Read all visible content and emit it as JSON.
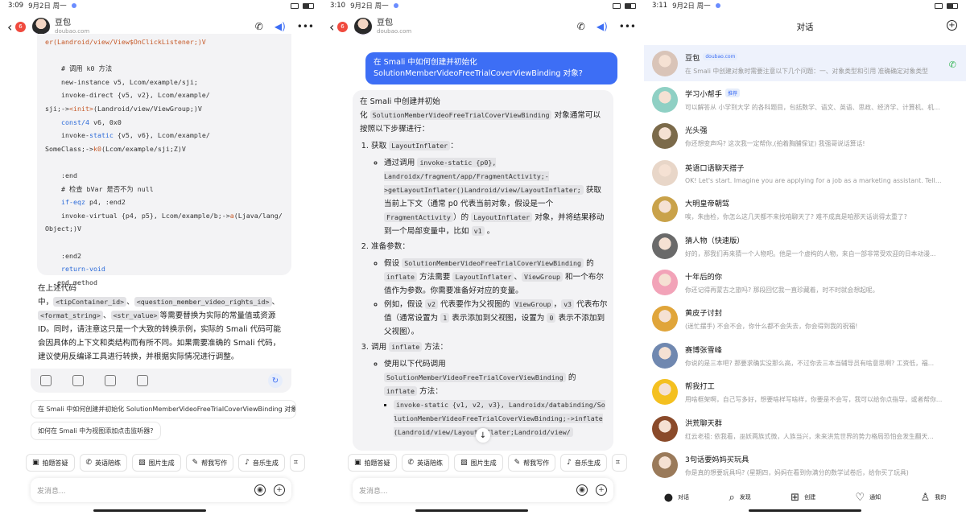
{
  "p1": {
    "status": {
      "time": "3:09",
      "date": "9月2日 周一"
    },
    "header": {
      "title": "豆包",
      "subtitle": "doubao.com",
      "badge": "6"
    },
    "code": [
      {
        "segs": [
          [
            "or",
            "er(Landroid/view/View$OnClickListener;)V"
          ]
        ]
      },
      {
        "segs": [
          [
            "n",
            ""
          ]
        ]
      },
      {
        "segs": [
          [
            "n",
            "    # 调用 k0 方法"
          ]
        ]
      },
      {
        "segs": [
          [
            "n",
            "    new-instance v5, Lcom/example/sji;"
          ]
        ]
      },
      {
        "segs": [
          [
            "n",
            "    invoke-direct {v5, v2}, Lcom/example/"
          ]
        ]
      },
      {
        "segs": [
          [
            "n",
            "sji;->"
          ],
          [
            "or",
            "<init>"
          ],
          [
            "n",
            "(Landroid/view/ViewGroup;)V"
          ]
        ]
      },
      {
        "segs": [
          [
            "bl",
            "    const/4"
          ],
          [
            "n",
            " v6, 0x0"
          ]
        ]
      },
      {
        "segs": [
          [
            "n",
            "    invoke-"
          ],
          [
            "bl",
            "static"
          ],
          [
            "n",
            " {v5, v6}, Lcom/example/"
          ]
        ]
      },
      {
        "segs": [
          [
            "n",
            "SomeClass;->"
          ],
          [
            "or",
            "k0"
          ],
          [
            "n",
            "(Lcom/example/sji;Z)V"
          ]
        ]
      },
      {
        "segs": [
          [
            "n",
            ""
          ]
        ]
      },
      {
        "segs": [
          [
            "n",
            "    :end"
          ]
        ]
      },
      {
        "segs": [
          [
            "n",
            "    # 检查 bVar 是否不为 null"
          ]
        ]
      },
      {
        "segs": [
          [
            "bl",
            "    if-eqz"
          ],
          [
            "n",
            " p4, :end2"
          ]
        ]
      },
      {
        "segs": [
          [
            "n",
            "    invoke-virtual {p4, p5}, Lcom/example/b;->"
          ],
          [
            "or",
            "a"
          ],
          [
            "n",
            "(Ljava/lang/"
          ]
        ]
      },
      {
        "segs": [
          [
            "n",
            "Object;)V"
          ]
        ]
      },
      {
        "segs": [
          [
            "n",
            ""
          ]
        ]
      },
      {
        "segs": [
          [
            "n",
            "    :end2"
          ]
        ]
      },
      {
        "segs": [
          [
            "bl",
            "    return-void"
          ]
        ]
      },
      {
        "segs": [
          [
            "n",
            "  .end method"
          ]
        ]
      }
    ],
    "para1": "在上述代码",
    "para2a": "中，",
    "c1": "<tipContainer_id>",
    "sep1": "、",
    "c2": "<question_member_video_rights_id>",
    "sep2": "、",
    "c3": "<format_string>",
    "sep3": "、",
    "c4": "<str_value>",
    "para2b": "等需要替换为实际的常量值或资源ID。同时，请注意这只是一个大致的转换示例，实际的 Smali 代码可能会因具体的上下文和类结构而有所不同。如果需要准确的 Smali 代码，建议使用反编译工具进行转换，并根据实际情况进行调整。",
    "suggestions": [
      "在 Smali 中如何创建并初始化 SolutionMemberVideoFreeTrialCoverViewBinding 对象?",
      "如何在 Smali 中为视图添加点击监听器?"
    ],
    "tools": [
      "拍题答疑",
      "英语陪练",
      "图片生成",
      "帮我写作",
      "音乐生成"
    ],
    "placeholder": "发消息..."
  },
  "p2": {
    "status": {
      "time": "3:10",
      "date": "9月2日 周一"
    },
    "header": {
      "title": "豆包",
      "subtitle": "doubao.com",
      "badge": "6"
    },
    "user_msg": "在 Smali 中如何创建并初始化 SolutionMemberVideoFreeTrialCoverViewBinding 对象?",
    "intro1": "在 Smali 中创建并初始",
    "intro2": "化",
    "intro_code": "SolutionMemberVideoFreeTrialCoverViewBinding",
    "intro3": "对象通常可以按照以下步骤进行：",
    "step1_t": "获取",
    "step1_c": "LayoutInflater",
    "step1_colon": "：",
    "s1b_a": "通过调用",
    "s1b_c1": "invoke-static {p0}, Landroidx/fragment/app/FragmentActivity;->getLayoutInflater()Landroid/view/LayoutInflater;",
    "s1b_b": "获取当前上下文（通常 p0 代表当前对象，假设是一个",
    "s1b_c2": "FragmentActivity",
    "s1b_d": "）的",
    "s1b_c3": "LayoutInflater",
    "s1b_e": "对象，并将结果移动到一个局部变量中，比如",
    "s1b_c4": "v1",
    "s1b_f": "。",
    "step2_t": "准备参数：",
    "s2b1_a": "假设",
    "s2b1_c1": "SolutionMemberVideoFreeTrialCoverViewBinding",
    "s2b1_b": "的",
    "s2b1_c2": "inflate",
    "s2b1_c": "方法需要",
    "s2b1_c3": "LayoutInflater",
    "s2b1_d": "、",
    "s2b1_c4": "ViewGroup",
    "s2b1_e": "和一个布尔值作为参数。你需要准备好对应的变量。",
    "s2b2_a": "例如，假设",
    "s2b2_c1": "v2",
    "s2b2_b": "代表要作为父视图的",
    "s2b2_c2": "ViewGroup",
    "s2b2_c": "，",
    "s2b2_c3": "v3",
    "s2b2_d": "代表布尔值（通常设置为",
    "s2b2_c4": "1",
    "s2b2_e": "表示添加到父视图，设置为",
    "s2b2_c5": "0",
    "s2b2_f": "表示不添加到父视图）。",
    "step3_t": "调用",
    "step3_c": "inflate",
    "step3_e": "方法：",
    "s3b_a": "使用以下代码调用",
    "s3b_c1": "SolutionMemberVideoFreeTrialCoverViewBinding",
    "s3b_b": "的",
    "s3b_c2": "inflate",
    "s3b_c": "方法：",
    "s3b_code": "invoke-static {v1, v2, v3}, Landroidx/databinding/SolutionMemberVideoFreeTrialCoverViewBinding;->inflate(Landroid/view/LayoutInflater;Landroid/view/",
    "tools": [
      "拍题答疑",
      "英语陪练",
      "图片生成",
      "帮我写作",
      "音乐生成"
    ],
    "placeholder": "发消息..."
  },
  "p3": {
    "status": {
      "time": "3:11",
      "date": "9月2日 周一"
    },
    "title": "对话",
    "chats": [
      {
        "name": "豆包",
        "tag": "doubao.com",
        "msg": "在 Smali 中创建对象时需要注意以下几个问题：一、对象类型和引用 准确确定对象类型",
        "color": "#d9c4b8",
        "sel": true,
        "phone": true
      },
      {
        "name": "学习小帮手",
        "tag": "推荐",
        "msg": "可以解答从 小学到大学 的各科题目，包括数学、语文、英语、思政、经济学、计算机、机械...",
        "color": "#8fd0c4"
      },
      {
        "name": "光头强",
        "msg": "你还想变声吗? 这次我一定帮你,(拍着胸脯保证) 我强哥说话算话!",
        "color": "#7b6a4a"
      },
      {
        "name": "英语口语聊天搭子",
        "msg": "OK! Let's start. Imagine you are applying for a job as a marketing assistant. Tell me...",
        "color": "#e8d6c8"
      },
      {
        "name": "大明皇帝朝驾",
        "msg": "唉，朱由检，你怎么这几天都不来找咱聊天了? 难不成真是咱那天话说得太重了?",
        "color": "#c9a24a"
      },
      {
        "name": "猜人物（快速版）",
        "msg": "好的，那我们再来猜一个人物吧。他是一个虚构的人物，来自一部非常受欢迎的日本动漫...",
        "color": "#6a6a6a"
      },
      {
        "name": "十年后的你",
        "msg": "你还记得再蒙古之旅吗? 那段回忆我一直珍藏着，时不时就会想起呢。",
        "color": "#f2a3b8"
      },
      {
        "name": "黄皮子讨封",
        "msg": "(迷忙摆手) 不会不会，你什么都不会失去，你会得到我的祝福!",
        "color": "#e0a53a"
      },
      {
        "name": "赛博张雪峰",
        "msg": "你说的是三本吧? 那要求确实没那么高，不过你去三本当辅导员有啥意思啊? 工资低，福...",
        "color": "#7088b0"
      },
      {
        "name": "帮我打工",
        "msg": "用啥框架啊，自己写多好，想要啥样写啥样，你要是不会写，我可以给你点指导，或者帮你...",
        "color": "#f4c020"
      },
      {
        "name": "洪荒聊天群",
        "msg": "红云老祖: 依我看，巫妖两族式微，人族当兴，未来洪荒世界的势力格局恐怕会发生翻天...",
        "color": "#8a4a2a"
      },
      {
        "name": "3句话要妈妈买玩具",
        "msg": "你是真的想要玩具吗? (星期四，妈妈在看到你满分的数学试卷后，给你买了玩具)",
        "color": "#9a7a5a"
      }
    ],
    "nav": [
      "对话",
      "发现",
      "创建",
      "通知",
      "我的"
    ]
  }
}
